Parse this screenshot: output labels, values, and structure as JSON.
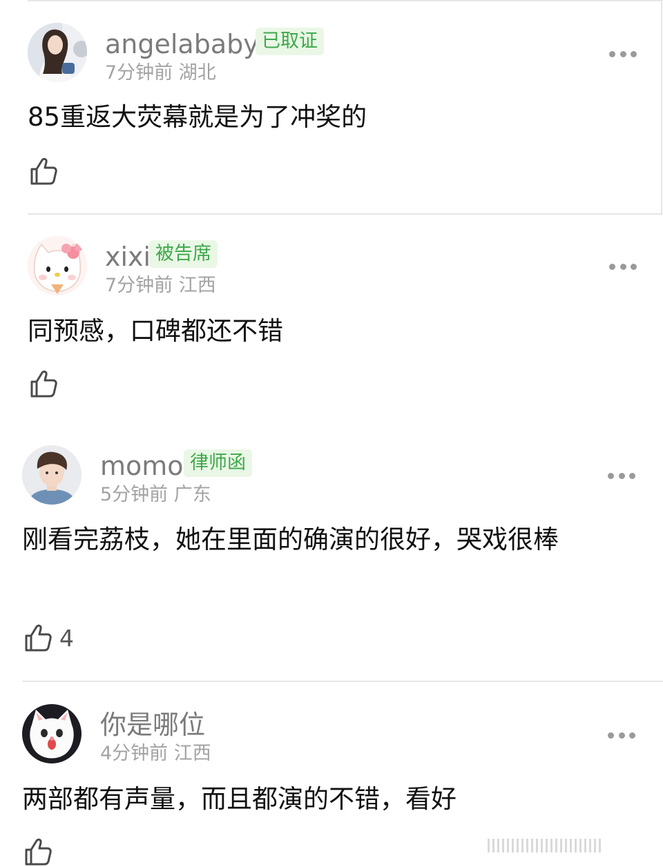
{
  "comments": [
    {
      "username": "angelababy",
      "badge": "已取证",
      "time": "7分钟前",
      "location": "湖北",
      "text": "85重返大荧幕就是为了冲奖的",
      "likes": "",
      "avatar_icon": "girl-photo-avatar"
    },
    {
      "username": "xixi",
      "badge": "被告席",
      "time": "7分钟前",
      "location": "江西",
      "text": "同预感，口碑都还不错",
      "likes": "",
      "avatar_icon": "hello-kitty-avatar"
    },
    {
      "username": "momo",
      "badge": "律师函",
      "time": "5分钟前",
      "location": "广东",
      "text": "刚看完荔枝，她在里面的确演的很好，哭戏很棒",
      "likes": "4",
      "avatar_icon": "boy-photo-avatar"
    },
    {
      "username": "你是哪位",
      "badge": "",
      "time": "4分钟前",
      "location": "江西",
      "text": "两部都有声量，而且都演的不错，看好",
      "likes": "",
      "avatar_icon": "white-cat-avatar"
    }
  ],
  "colors": {
    "badge_bg": "#eaf7e6",
    "badge_text": "#3ea84a",
    "username": "#7b7b7b",
    "meta": "#a3a3a3"
  }
}
